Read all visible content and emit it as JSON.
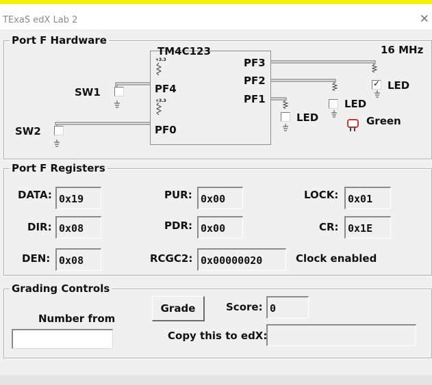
{
  "window": {
    "title": "TExaS edX Lab 2",
    "close_symbol": "✕"
  },
  "hardware": {
    "group_title": "Port F Hardware",
    "chip_name": "TM4C123",
    "clock": "16 MHz",
    "pins": {
      "pf4": "PF4",
      "pf0": "PF0",
      "pf3": "PF3",
      "pf2": "PF2",
      "pf1": "PF1"
    },
    "switches": {
      "sw1": "SW1",
      "sw2": "SW2"
    },
    "pullup_label": "+3.3",
    "leds": [
      {
        "label": "LED",
        "checked": true
      },
      {
        "label": "LED",
        "checked": false
      },
      {
        "label": "LED",
        "checked": false
      }
    ],
    "led_color_label": "Green",
    "led_color": "#cc3333"
  },
  "registers": {
    "group_title": "Port F Registers",
    "data": {
      "label": "DATA:",
      "value": "0x19"
    },
    "dir": {
      "label": "DIR:",
      "value": "0x08"
    },
    "den": {
      "label": "DEN:",
      "value": "0x08"
    },
    "pur": {
      "label": "PUR:",
      "value": "0x00"
    },
    "pdr": {
      "label": "PDR:",
      "value": "0x00"
    },
    "rcgc2": {
      "label": "RCGC2:",
      "value": "0x00000020"
    },
    "lock": {
      "label": "LOCK:",
      "value": "0x01"
    },
    "cr": {
      "label": "CR:",
      "value": "0x1E"
    },
    "clock_status": "Clock enabled"
  },
  "grading": {
    "group_title": "Grading Controls",
    "number_from_label": "Number from",
    "number_from_value": "",
    "grade_button": "Grade",
    "score_label": "Score:",
    "score_value": "0",
    "copy_label": "Copy this to edX:",
    "copy_value": ""
  },
  "colors": {
    "highlight_bar": "#f0f000",
    "panel_bg": "#f0f0f0",
    "wire": "#666666"
  }
}
